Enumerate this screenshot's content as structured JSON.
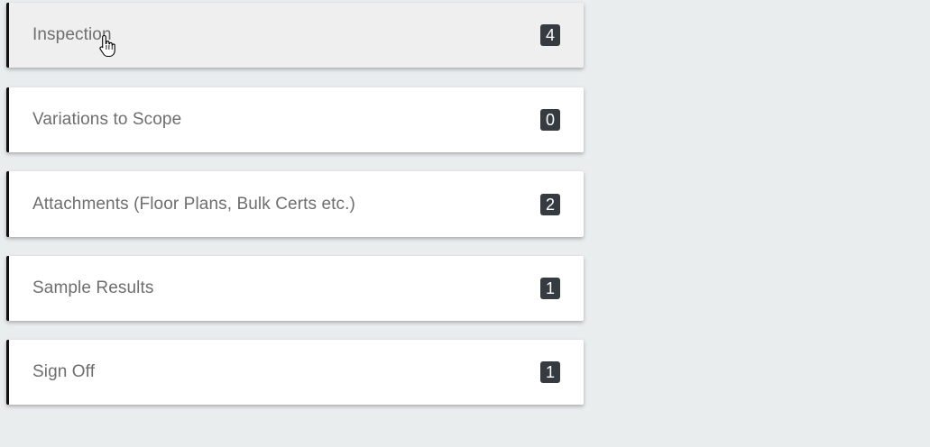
{
  "panels": [
    {
      "label": "Inspection",
      "count": "4"
    },
    {
      "label": "Variations to Scope",
      "count": "0"
    },
    {
      "label": "Attachments (Floor Plans, Bulk Certs etc.)",
      "count": "2"
    },
    {
      "label": "Sample Results",
      "count": "1"
    },
    {
      "label": "Sign Off",
      "count": "1"
    }
  ],
  "colors": {
    "background": "#e9edee",
    "panel": "#ffffff",
    "panel_hover": "#efefef",
    "accent_border": "#111111",
    "badge": "#353b40"
  },
  "cursor_icon": "hand-pointer-icon"
}
